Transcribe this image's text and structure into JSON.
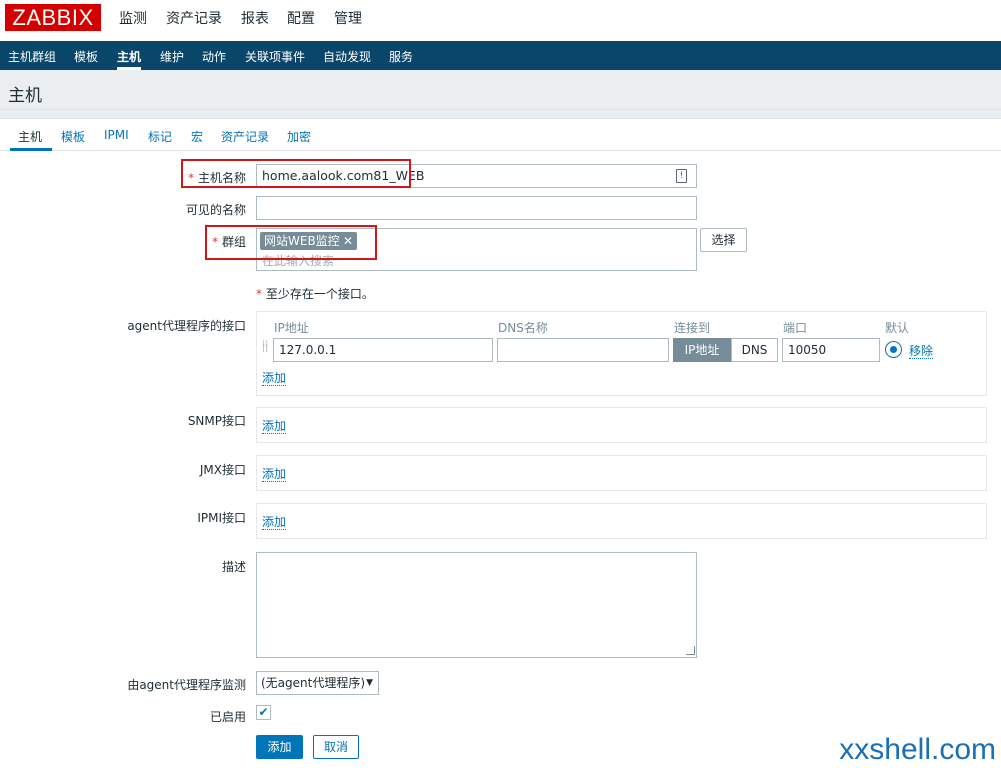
{
  "logo": "ZABBIX",
  "top_nav": [
    "监测",
    "资产记录",
    "报表",
    "配置",
    "管理"
  ],
  "sub_nav": [
    "主机群组",
    "模板",
    "主机",
    "维护",
    "动作",
    "关联项事件",
    "自动发现",
    "服务"
  ],
  "page_title": "主机",
  "tabs": [
    "主机",
    "模板",
    "IPMI",
    "标记",
    "宏",
    "资产记录",
    "加密"
  ],
  "form": {
    "hostname_label": "主机名称",
    "hostname_value": "home.aalook.com81_WEB",
    "visible_name_label": "可见的名称",
    "visible_name_value": "",
    "groups_label": "群组",
    "group_tag": "网站WEB监控",
    "group_search_placeholder": "在此输入搜索",
    "select_button": "选择",
    "interface_note": "至少存在一个接口。",
    "agent_iface_label": "agent代理程序的接口",
    "col_ip": "IP地址",
    "col_dns": "DNS名称",
    "col_connect": "连接到",
    "col_port": "端口",
    "col_default": "默认",
    "ip_value": "127.0.0.1",
    "dns_value": "",
    "connect_ip": "IP地址",
    "connect_dns": "DNS",
    "port_value": "10050",
    "remove_link": "移除",
    "add_link": "添加",
    "snmp_label": "SNMP接口",
    "jmx_label": "JMX接口",
    "ipmi_label": "IPMI接口",
    "description_label": "描述",
    "description_value": "",
    "monitored_by_label": "由agent代理程序监测",
    "monitored_by_value": "(无agent代理程序)",
    "enabled_label": "已启用",
    "enabled": true,
    "submit_button": "添加",
    "cancel_button": "取消"
  },
  "watermark": "xxshell.com",
  "colors": {
    "brand_red": "#d40000",
    "nav_blue": "#0a466a",
    "link_blue": "#0275b8",
    "annotation_red": "#d01818"
  }
}
